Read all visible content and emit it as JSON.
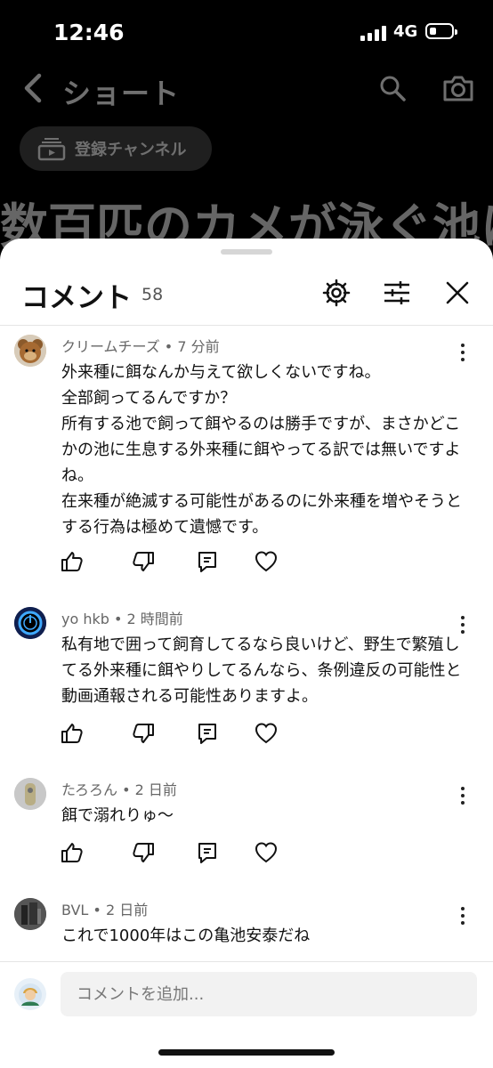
{
  "status": {
    "time": "12:46",
    "network": "4G",
    "signal_icon": "signal-bars-icon",
    "battery_icon": "battery-icon"
  },
  "header": {
    "title": "ショート",
    "subscription_chip": "登録チャンネル",
    "overlay_title": "数百匹のカメが泳ぐ池に"
  },
  "comments_panel": {
    "title": "コメント",
    "count": "58",
    "icons": [
      "gear-icon",
      "filter-icon",
      "close-icon"
    ],
    "comments": [
      {
        "author_meta": "クリームチーズ • 7 分前",
        "text": "外来種に餌なんか与えて欲しくないですね。\n全部飼ってるんですか？\n所有する池で飼って餌やるのは勝手ですが、まさかどこかの池に生息する外来種に餌やってる訳では無いですよね。\n在来種が絶滅する可能性があるのに外来種を増やそうとする行為は極めて遺憾です。",
        "avatar_icon": "teddy-bear-avatar-icon"
      },
      {
        "author_meta": "yo hkb • 2 時間前",
        "text": "私有地で囲って飼育してるなら良いけど、野生で繁殖してる外来種に餌やりしてるんなら、条例違反の可能性と動画通報される可能性ありますよ。",
        "avatar_icon": "blue-circle-avatar-icon"
      },
      {
        "author_meta": "たろろん • 2 日前",
        "text": "餌で溺れりゅ〜",
        "avatar_icon": "photo-avatar-icon"
      },
      {
        "author_meta": "BVL • 2 日前",
        "text": "これで1000年はこの亀池安泰だね",
        "avatar_icon": "dark-photo-avatar-icon"
      }
    ],
    "composer": {
      "placeholder": "コメントを追加..."
    }
  }
}
